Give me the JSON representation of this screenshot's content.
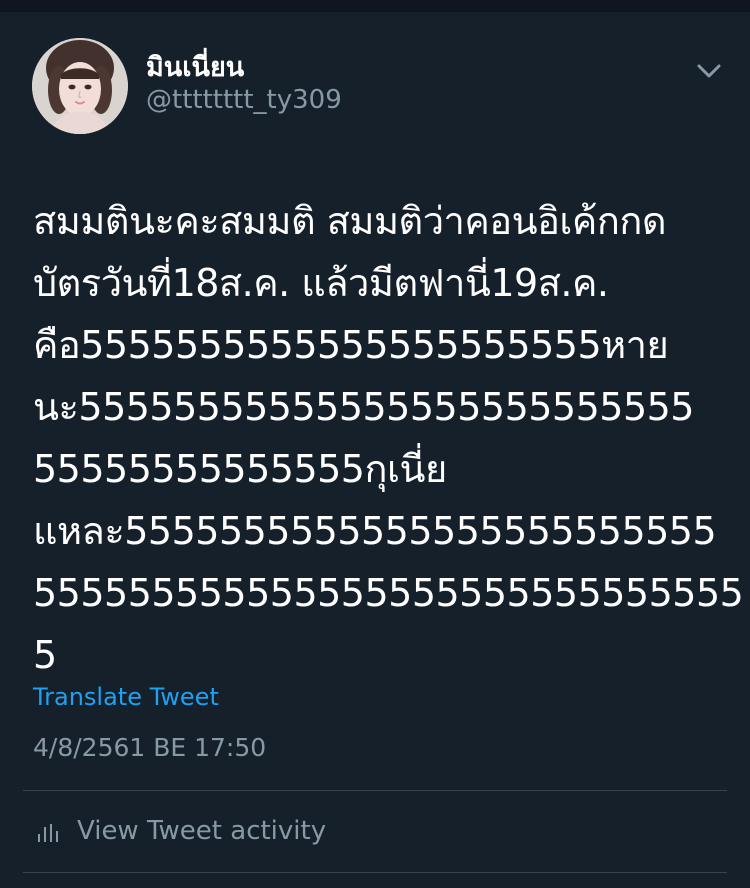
{
  "colors": {
    "background": "#15202b",
    "primary_text": "#ffffff",
    "secondary_text": "#8899a6",
    "accent": "#1da1f2",
    "divider": "#38444d"
  },
  "author": {
    "display_name": "มินเนี่ยน",
    "handle": "@tttttttt_ty309",
    "avatar_icon": "profile-photo"
  },
  "menu": {
    "icon": "chevron-down-icon"
  },
  "tweet": {
    "lines": [
      "สมมตินะคะสมมติ สมมติว่าคอนอิเค้กกด",
      "บัตรวันที่18ส.ค. แล้วมีตฟานี่19ส.ค.",
      "คือ5555555555555555555555หาย",
      "นะ55555555555555555555555555",
      "55555555555555กุเนี่ย",
      "แหละ5555555555555555555555555",
      "555555555555555555555555555555",
      "5"
    ],
    "translate_label": "Translate Tweet",
    "timestamp": "4/8/2561 BE 17:50"
  },
  "activity": {
    "icon": "bar-chart-icon",
    "label": "View Tweet activity"
  }
}
